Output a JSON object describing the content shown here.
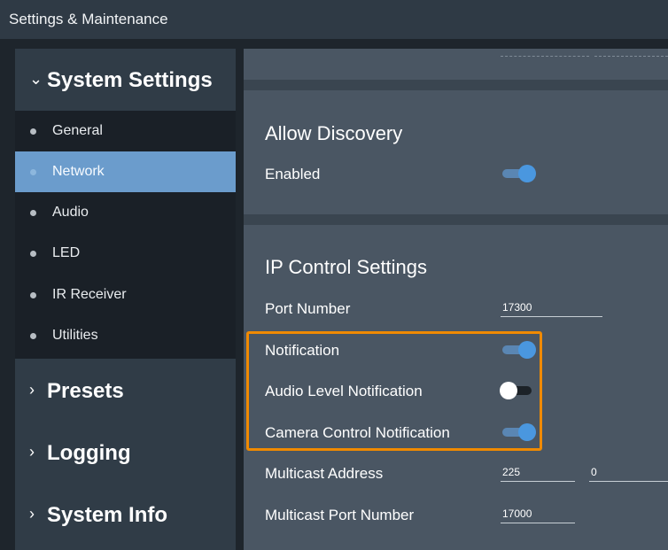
{
  "window": {
    "title": "Settings & Maintenance"
  },
  "sidebar": {
    "system_settings": {
      "label": "System Settings",
      "chevron": "chevron-down-icon"
    },
    "items": [
      {
        "label": "General",
        "active": false
      },
      {
        "label": "Network",
        "active": true
      },
      {
        "label": "Audio",
        "active": false
      },
      {
        "label": "LED",
        "active": false
      },
      {
        "label": "IR Receiver",
        "active": false
      },
      {
        "label": "Utilities",
        "active": false
      }
    ],
    "presets": {
      "label": "Presets",
      "chevron": "chevron-right-icon"
    },
    "logging": {
      "label": "Logging",
      "chevron": "chevron-right-icon"
    },
    "system_info": {
      "label": "System Info",
      "chevron": "chevron-right-icon"
    }
  },
  "allow_discovery": {
    "title": "Allow Discovery",
    "enabled": {
      "label": "Enabled",
      "on": true
    }
  },
  "ip_control": {
    "title": "IP Control Settings",
    "port_number": {
      "label": "Port Number",
      "value": "17300"
    },
    "notification": {
      "label": "Notification",
      "on": true
    },
    "audio_level_notification": {
      "label": "Audio Level Notification",
      "on": false
    },
    "camera_control_notification": {
      "label": "Camera Control Notification",
      "on": true
    },
    "multicast_address": {
      "label": "Multicast Address",
      "octet1": "225",
      "octet2": "0"
    },
    "multicast_port_number": {
      "label": "Multicast Port Number",
      "value": "17000"
    }
  },
  "colors": {
    "accent_active": "#6b9ccc",
    "toggle_on": "#4a97df",
    "highlight": "#f08a00"
  }
}
